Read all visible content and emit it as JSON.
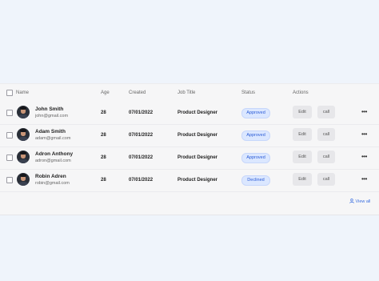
{
  "table": {
    "columns": [
      "Name",
      "Age",
      "Created",
      "Job Title",
      "Status",
      "Actions"
    ],
    "rows": [
      {
        "name": "John Smith",
        "email": "john@gmail.com",
        "age": "28",
        "created": "07/01/2022",
        "job": "Product Designer",
        "status": "Approved"
      },
      {
        "name": "Adam Smith",
        "email": "adam@gmail.com",
        "age": "28",
        "created": "07/01/2022",
        "job": "Product Designer",
        "status": "Approved"
      },
      {
        "name": "Adron Anthony",
        "email": "adron@gmail.com",
        "age": "28",
        "created": "07/01/2022",
        "job": "Product Designer",
        "status": "Approved"
      },
      {
        "name": "Robin Adren",
        "email": "robin@gmail.com",
        "age": "28",
        "created": "07/01/2022",
        "job": "Product Designer",
        "status": "Declined"
      }
    ],
    "edit_label": "Edit",
    "call_label": "call",
    "more_label": "•••",
    "view_all": "View all"
  },
  "colors": {
    "page_bg": "#eff4fb",
    "panel_bg": "#f6f6f7",
    "badge_bg": "#dbe7ff",
    "badge_text": "#2a5bd6",
    "link": "#3b6fe0"
  },
  "icons": {
    "view_all": "user-icon",
    "actions": "more-horizontal-icon"
  }
}
